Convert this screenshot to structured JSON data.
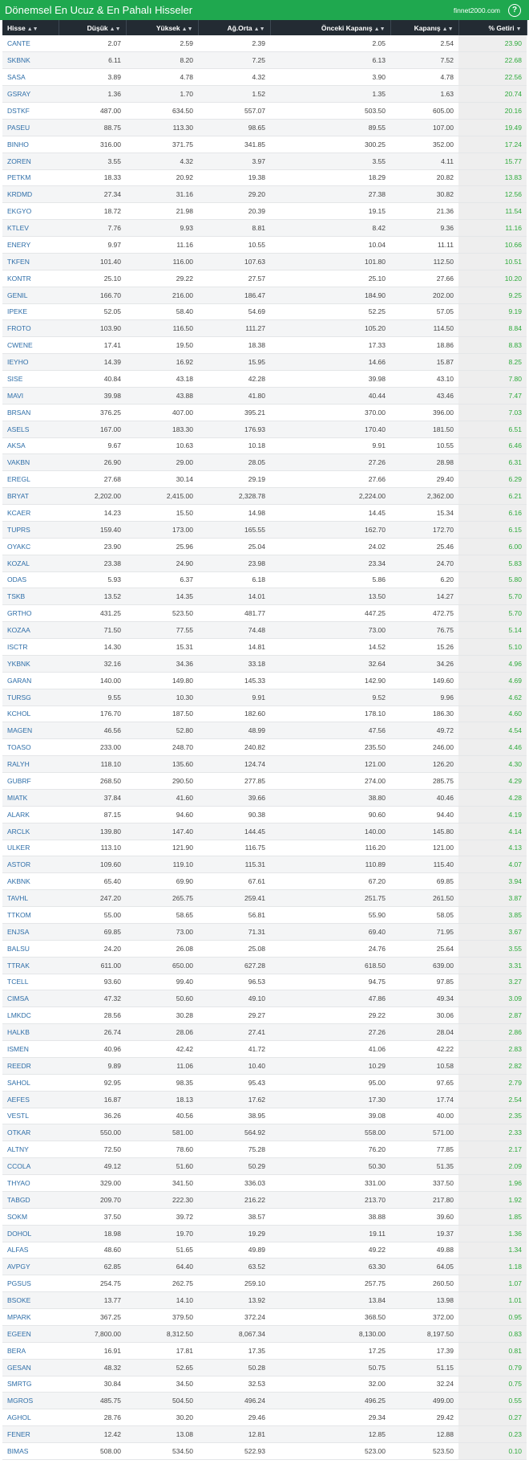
{
  "header": {
    "title": "Dönemsel En Ucuz & En Pahalı Hisseler",
    "site": "finnet2000.com",
    "help_icon": "?"
  },
  "columns": [
    "Hisse",
    "Düşük",
    "Yüksek",
    "Ağ.Orta",
    "Önceki Kapanış",
    "Kapanış",
    "% Getiri"
  ],
  "colors": {
    "header_bg": "#1fa84f",
    "table_header_bg": "#232b33",
    "symbol": "#2e6ea8",
    "gain": "#2eaa3b"
  },
  "rows": [
    [
      "CANTE",
      "2.07",
      "2.59",
      "2.39",
      "2.05",
      "2.54",
      "23.90"
    ],
    [
      "SKBNK",
      "6.11",
      "8.20",
      "7.25",
      "6.13",
      "7.52",
      "22.68"
    ],
    [
      "SASA",
      "3.89",
      "4.78",
      "4.32",
      "3.90",
      "4.78",
      "22.56"
    ],
    [
      "GSRAY",
      "1.36",
      "1.70",
      "1.52",
      "1.35",
      "1.63",
      "20.74"
    ],
    [
      "DSTKF",
      "487.00",
      "634.50",
      "557.07",
      "503.50",
      "605.00",
      "20.16"
    ],
    [
      "PASEU",
      "88.75",
      "113.30",
      "98.65",
      "89.55",
      "107.00",
      "19.49"
    ],
    [
      "BINHO",
      "316.00",
      "371.75",
      "341.85",
      "300.25",
      "352.00",
      "17.24"
    ],
    [
      "ZOREN",
      "3.55",
      "4.32",
      "3.97",
      "3.55",
      "4.11",
      "15.77"
    ],
    [
      "PETKM",
      "18.33",
      "20.92",
      "19.38",
      "18.29",
      "20.82",
      "13.83"
    ],
    [
      "KRDMD",
      "27.34",
      "31.16",
      "29.20",
      "27.38",
      "30.82",
      "12.56"
    ],
    [
      "EKGYO",
      "18.72",
      "21.98",
      "20.39",
      "19.15",
      "21.36",
      "11.54"
    ],
    [
      "KTLEV",
      "7.76",
      "9.93",
      "8.81",
      "8.42",
      "9.36",
      "11.16"
    ],
    [
      "ENERY",
      "9.97",
      "11.16",
      "10.55",
      "10.04",
      "11.11",
      "10.66"
    ],
    [
      "TKFEN",
      "101.40",
      "116.00",
      "107.63",
      "101.80",
      "112.50",
      "10.51"
    ],
    [
      "KONTR",
      "25.10",
      "29.22",
      "27.57",
      "25.10",
      "27.66",
      "10.20"
    ],
    [
      "GENIL",
      "166.70",
      "216.00",
      "186.47",
      "184.90",
      "202.00",
      "9.25"
    ],
    [
      "IPEKE",
      "52.05",
      "58.40",
      "54.69",
      "52.25",
      "57.05",
      "9.19"
    ],
    [
      "FROTO",
      "103.90",
      "116.50",
      "111.27",
      "105.20",
      "114.50",
      "8.84"
    ],
    [
      "CWENE",
      "17.41",
      "19.50",
      "18.38",
      "17.33",
      "18.86",
      "8.83"
    ],
    [
      "IEYHO",
      "14.39",
      "16.92",
      "15.95",
      "14.66",
      "15.87",
      "8.25"
    ],
    [
      "SISE",
      "40.84",
      "43.18",
      "42.28",
      "39.98",
      "43.10",
      "7.80"
    ],
    [
      "MAVI",
      "39.98",
      "43.88",
      "41.80",
      "40.44",
      "43.46",
      "7.47"
    ],
    [
      "BRSAN",
      "376.25",
      "407.00",
      "395.21",
      "370.00",
      "396.00",
      "7.03"
    ],
    [
      "ASELS",
      "167.00",
      "183.30",
      "176.93",
      "170.40",
      "181.50",
      "6.51"
    ],
    [
      "AKSA",
      "9.67",
      "10.63",
      "10.18",
      "9.91",
      "10.55",
      "6.46"
    ],
    [
      "VAKBN",
      "26.90",
      "29.00",
      "28.05",
      "27.26",
      "28.98",
      "6.31"
    ],
    [
      "EREGL",
      "27.68",
      "30.14",
      "29.19",
      "27.66",
      "29.40",
      "6.29"
    ],
    [
      "BRYAT",
      "2,202.00",
      "2,415.00",
      "2,328.78",
      "2,224.00",
      "2,362.00",
      "6.21"
    ],
    [
      "KCAER",
      "14.23",
      "15.50",
      "14.98",
      "14.45",
      "15.34",
      "6.16"
    ],
    [
      "TUPRS",
      "159.40",
      "173.00",
      "165.55",
      "162.70",
      "172.70",
      "6.15"
    ],
    [
      "OYAKC",
      "23.90",
      "25.96",
      "25.04",
      "24.02",
      "25.46",
      "6.00"
    ],
    [
      "KOZAL",
      "23.38",
      "24.90",
      "23.98",
      "23.34",
      "24.70",
      "5.83"
    ],
    [
      "ODAS",
      "5.93",
      "6.37",
      "6.18",
      "5.86",
      "6.20",
      "5.80"
    ],
    [
      "TSKB",
      "13.52",
      "14.35",
      "14.01",
      "13.50",
      "14.27",
      "5.70"
    ],
    [
      "GRTHO",
      "431.25",
      "523.50",
      "481.77",
      "447.25",
      "472.75",
      "5.70"
    ],
    [
      "KOZAA",
      "71.50",
      "77.55",
      "74.48",
      "73.00",
      "76.75",
      "5.14"
    ],
    [
      "ISCTR",
      "14.30",
      "15.31",
      "14.81",
      "14.52",
      "15.26",
      "5.10"
    ],
    [
      "YKBNK",
      "32.16",
      "34.36",
      "33.18",
      "32.64",
      "34.26",
      "4.96"
    ],
    [
      "GARAN",
      "140.00",
      "149.80",
      "145.33",
      "142.90",
      "149.60",
      "4.69"
    ],
    [
      "TURSG",
      "9.55",
      "10.30",
      "9.91",
      "9.52",
      "9.96",
      "4.62"
    ],
    [
      "KCHOL",
      "176.70",
      "187.50",
      "182.60",
      "178.10",
      "186.30",
      "4.60"
    ],
    [
      "MAGEN",
      "46.56",
      "52.80",
      "48.99",
      "47.56",
      "49.72",
      "4.54"
    ],
    [
      "TOASO",
      "233.00",
      "248.70",
      "240.82",
      "235.50",
      "246.00",
      "4.46"
    ],
    [
      "RALYH",
      "118.10",
      "135.60",
      "124.74",
      "121.00",
      "126.20",
      "4.30"
    ],
    [
      "GUBRF",
      "268.50",
      "290.50",
      "277.85",
      "274.00",
      "285.75",
      "4.29"
    ],
    [
      "MIATK",
      "37.84",
      "41.60",
      "39.66",
      "38.80",
      "40.46",
      "4.28"
    ],
    [
      "ALARK",
      "87.15",
      "94.60",
      "90.38",
      "90.60",
      "94.40",
      "4.19"
    ],
    [
      "ARCLK",
      "139.80",
      "147.40",
      "144.45",
      "140.00",
      "145.80",
      "4.14"
    ],
    [
      "ULKER",
      "113.10",
      "121.90",
      "116.75",
      "116.20",
      "121.00",
      "4.13"
    ],
    [
      "ASTOR",
      "109.60",
      "119.10",
      "115.31",
      "110.89",
      "115.40",
      "4.07"
    ],
    [
      "AKBNK",
      "65.40",
      "69.90",
      "67.61",
      "67.20",
      "69.85",
      "3.94"
    ],
    [
      "TAVHL",
      "247.20",
      "265.75",
      "259.41",
      "251.75",
      "261.50",
      "3.87"
    ],
    [
      "TTKOM",
      "55.00",
      "58.65",
      "56.81",
      "55.90",
      "58.05",
      "3.85"
    ],
    [
      "ENJSA",
      "69.85",
      "73.00",
      "71.31",
      "69.40",
      "71.95",
      "3.67"
    ],
    [
      "BALSU",
      "24.20",
      "26.08",
      "25.08",
      "24.76",
      "25.64",
      "3.55"
    ],
    [
      "TTRAK",
      "611.00",
      "650.00",
      "627.28",
      "618.50",
      "639.00",
      "3.31"
    ],
    [
      "TCELL",
      "93.60",
      "99.40",
      "96.53",
      "94.75",
      "97.85",
      "3.27"
    ],
    [
      "CIMSA",
      "47.32",
      "50.60",
      "49.10",
      "47.86",
      "49.34",
      "3.09"
    ],
    [
      "LMKDC",
      "28.56",
      "30.28",
      "29.27",
      "29.22",
      "30.06",
      "2.87"
    ],
    [
      "HALKB",
      "26.74",
      "28.06",
      "27.41",
      "27.26",
      "28.04",
      "2.86"
    ],
    [
      "ISMEN",
      "40.96",
      "42.42",
      "41.72",
      "41.06",
      "42.22",
      "2.83"
    ],
    [
      "REEDR",
      "9.89",
      "11.06",
      "10.40",
      "10.29",
      "10.58",
      "2.82"
    ],
    [
      "SAHOL",
      "92.95",
      "98.35",
      "95.43",
      "95.00",
      "97.65",
      "2.79"
    ],
    [
      "AEFES",
      "16.87",
      "18.13",
      "17.62",
      "17.30",
      "17.74",
      "2.54"
    ],
    [
      "VESTL",
      "36.26",
      "40.56",
      "38.95",
      "39.08",
      "40.00",
      "2.35"
    ],
    [
      "OTKAR",
      "550.00",
      "581.00",
      "564.92",
      "558.00",
      "571.00",
      "2.33"
    ],
    [
      "ALTNY",
      "72.50",
      "78.60",
      "75.28",
      "76.20",
      "77.85",
      "2.17"
    ],
    [
      "CCOLA",
      "49.12",
      "51.60",
      "50.29",
      "50.30",
      "51.35",
      "2.09"
    ],
    [
      "THYAO",
      "329.00",
      "341.50",
      "336.03",
      "331.00",
      "337.50",
      "1.96"
    ],
    [
      "TABGD",
      "209.70",
      "222.30",
      "216.22",
      "213.70",
      "217.80",
      "1.92"
    ],
    [
      "SOKM",
      "37.50",
      "39.72",
      "38.57",
      "38.88",
      "39.60",
      "1.85"
    ],
    [
      "DOHOL",
      "18.98",
      "19.70",
      "19.29",
      "19.11",
      "19.37",
      "1.36"
    ],
    [
      "ALFAS",
      "48.60",
      "51.65",
      "49.89",
      "49.22",
      "49.88",
      "1.34"
    ],
    [
      "AVPGY",
      "62.85",
      "64.40",
      "63.52",
      "63.30",
      "64.05",
      "1.18"
    ],
    [
      "PGSUS",
      "254.75",
      "262.75",
      "259.10",
      "257.75",
      "260.50",
      "1.07"
    ],
    [
      "BSOKE",
      "13.77",
      "14.10",
      "13.92",
      "13.84",
      "13.98",
      "1.01"
    ],
    [
      "MPARK",
      "367.25",
      "379.50",
      "372.24",
      "368.50",
      "372.00",
      "0.95"
    ],
    [
      "EGEEN",
      "7,800.00",
      "8,312.50",
      "8,067.34",
      "8,130.00",
      "8,197.50",
      "0.83"
    ],
    [
      "BERA",
      "16.91",
      "17.81",
      "17.35",
      "17.25",
      "17.39",
      "0.81"
    ],
    [
      "GESAN",
      "48.32",
      "52.65",
      "50.28",
      "50.75",
      "51.15",
      "0.79"
    ],
    [
      "SMRTG",
      "30.84",
      "34.50",
      "32.53",
      "32.00",
      "32.24",
      "0.75"
    ],
    [
      "MGROS",
      "485.75",
      "504.50",
      "496.24",
      "496.25",
      "499.00",
      "0.55"
    ],
    [
      "AGHOL",
      "28.76",
      "30.20",
      "29.46",
      "29.34",
      "29.42",
      "0.27"
    ],
    [
      "FENER",
      "12.42",
      "13.08",
      "12.81",
      "12.85",
      "12.88",
      "0.23"
    ],
    [
      "BIMAS",
      "508.00",
      "534.50",
      "522.93",
      "523.00",
      "523.50",
      "0.10"
    ]
  ]
}
